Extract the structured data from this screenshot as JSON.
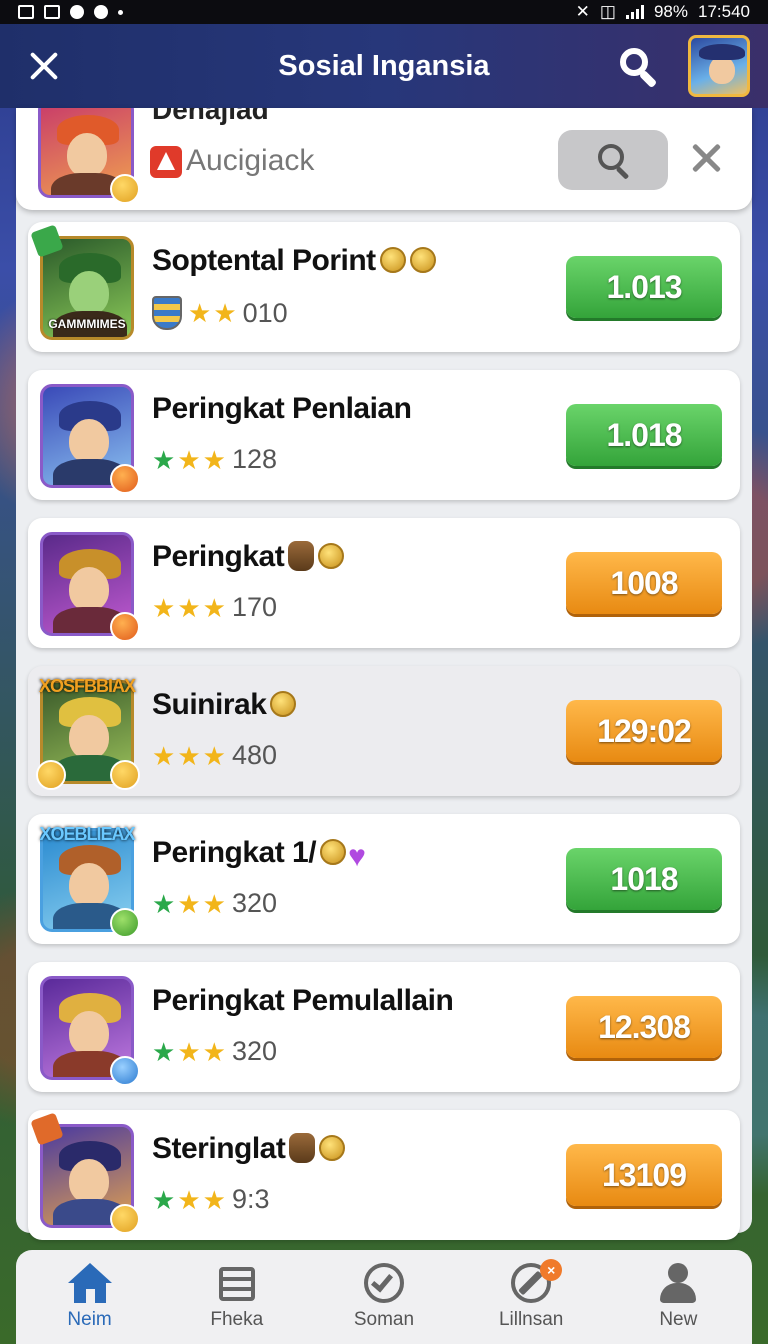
{
  "status_bar": {
    "time": "17:540",
    "battery": "98%"
  },
  "header": {
    "title": "Sosial Ingansia"
  },
  "search": {
    "partial_title": "Denajiad",
    "query": "Aucigiack"
  },
  "rows": [
    {
      "title": "Soptental Porint",
      "meta_value": "010",
      "button_value": "1.013",
      "button_color": "#34a43a",
      "avatar_caption": "GAMMMIMES"
    },
    {
      "title": "Peringkat Penlaian",
      "meta_value": "128",
      "button_value": "1.018",
      "button_color": "#34a43a"
    },
    {
      "title": "Peringkat",
      "meta_value": "170",
      "button_value": "1008",
      "button_color": "#e88a12"
    },
    {
      "title": "Suinirak",
      "meta_value": "480",
      "button_value": "129:02",
      "button_color": "#e88a12",
      "avatar_banner": "XOSFBBIAX"
    },
    {
      "title": "Peringkat 1/",
      "meta_value": "320",
      "button_value": "1018",
      "button_color": "#34a43a",
      "avatar_banner": "XOEBLIEAX"
    },
    {
      "title": "Peringkat Pemulallain",
      "meta_value": "320",
      "button_value": "12.308",
      "button_color": "#e88a12"
    },
    {
      "title": "Steringlat",
      "meta_value": "9:3",
      "button_value": "13109",
      "button_color": "#e88a12"
    }
  ],
  "bottom_nav": {
    "items": [
      {
        "label": "Neim",
        "icon": "home-icon",
        "active": true
      },
      {
        "label": "Fheka",
        "icon": "calendar-icon"
      },
      {
        "label": "Soman",
        "icon": "check-circle-icon"
      },
      {
        "label": "Lillnsan",
        "icon": "edit-icon",
        "badge": "×"
      },
      {
        "label": "New",
        "icon": "user-icon"
      }
    ]
  },
  "colors": {
    "accent": "#2a6ab8",
    "green": "#34a43a",
    "orange": "#e88a12",
    "header": "#27377a"
  }
}
